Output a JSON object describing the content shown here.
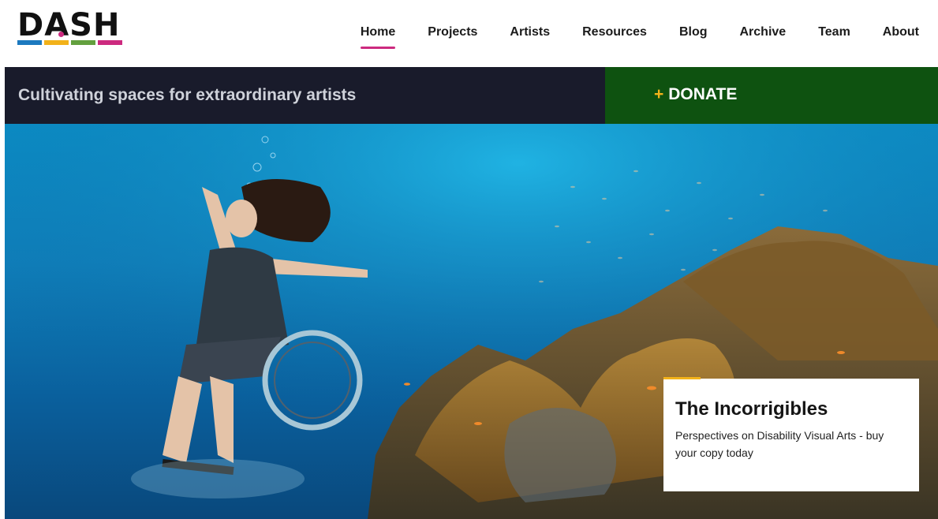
{
  "logo": {
    "text": "DASH",
    "dot_color": "#cc2a7f",
    "bar_colors": [
      "#1c79bf",
      "#f2b21a",
      "#63a03e",
      "#cc2a7f"
    ]
  },
  "nav": {
    "items": [
      "Home",
      "Projects",
      "Artists",
      "Resources",
      "Blog",
      "Archive",
      "Team",
      "About"
    ],
    "active": "Home",
    "active_underline_color": "#cc2a7f"
  },
  "banner": {
    "tagline": "Cultivating spaces for extraordinary artists",
    "tagline_bg": "#191b2b",
    "donate_plus": "+",
    "donate_label": "DONATE",
    "donate_bg": "#0e5210",
    "donate_plus_color": "#f2b21a"
  },
  "hero": {
    "image_description_icon": "underwater-wheelchair-diver-photo"
  },
  "feature_card": {
    "title": "The Incorrigibles",
    "text": "Perspectives on Disability Visual Arts - buy your copy today",
    "accent_color": "#f2b21a"
  }
}
